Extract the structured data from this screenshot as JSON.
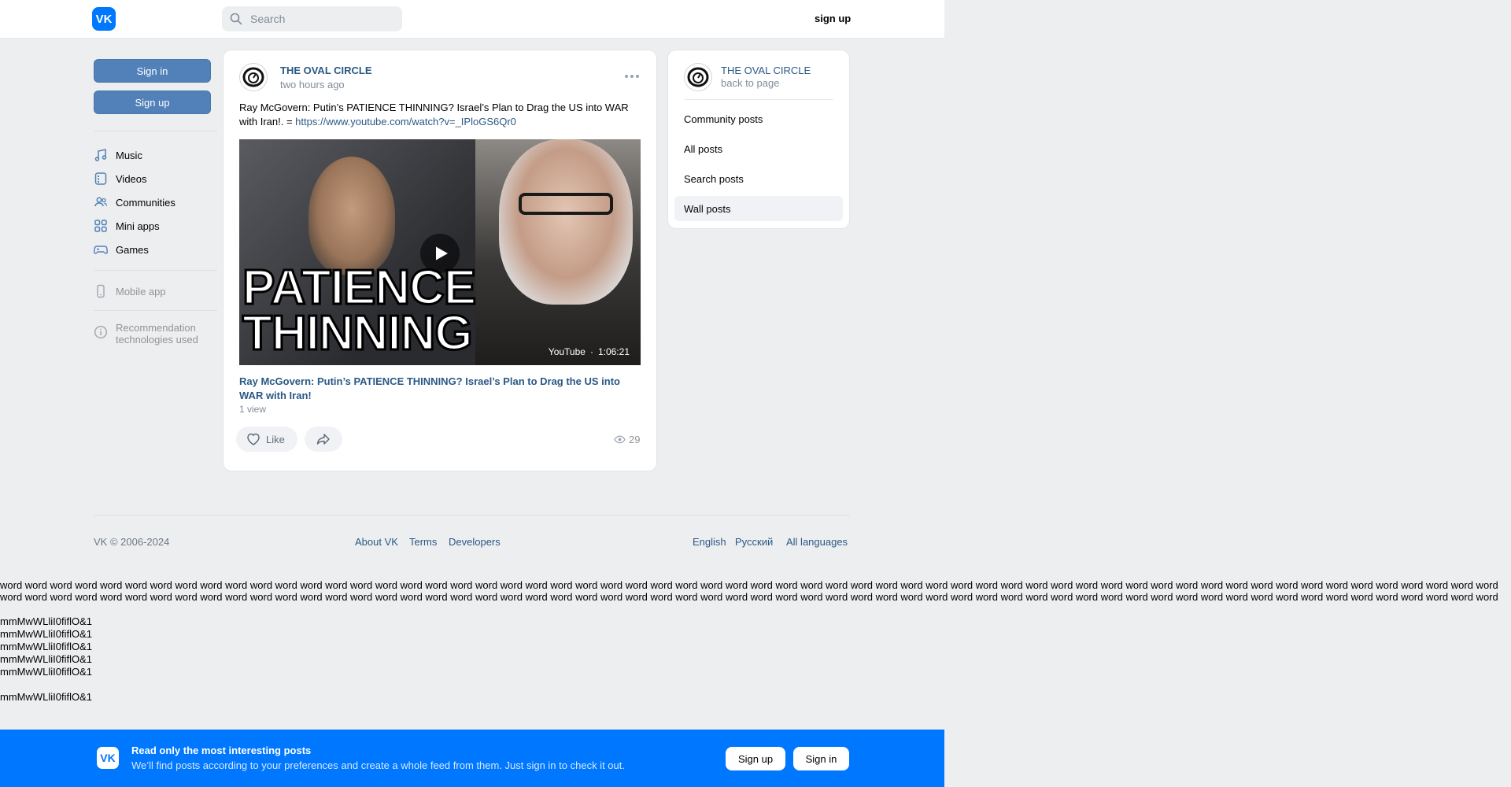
{
  "header": {
    "logo": "VK",
    "search_placeholder": "Search",
    "signup": "sign up"
  },
  "sidebar": {
    "signin": "Sign in",
    "signup": "Sign up",
    "menu": [
      {
        "label": "Music",
        "icon": "music-icon"
      },
      {
        "label": "Videos",
        "icon": "video-icon"
      },
      {
        "label": "Communities",
        "icon": "communities-icon"
      },
      {
        "label": "Mini apps",
        "icon": "apps-icon"
      },
      {
        "label": "Games",
        "icon": "gamepad-icon"
      }
    ],
    "mobile_app": "Mobile app",
    "recommendation": "Recommendation technologies used"
  },
  "post": {
    "author": "THE OVAL CIRCLE",
    "time": "two hours ago",
    "text": "Ray McGovern: Putin’s PATIENCE THINNING? Israel’s Plan to Drag the US into WAR with Iran!. = ",
    "link": "https://www.youtube.com/watch?v=_IPloGS6Qr0",
    "video": {
      "thumb_line1": "PATIENCE",
      "thumb_line2": "THINNING",
      "source": "YouTube",
      "separator": "·",
      "duration": "1:06:21",
      "title": "Ray McGovern: Putin’s PATIENCE THINNING? Israel’s Plan to Drag the US into WAR with Iran!",
      "views": "1 view"
    },
    "like_label": "Like",
    "view_count": "29"
  },
  "right_panel": {
    "name": "THE OVAL CIRCLE",
    "back": "back to page",
    "items": [
      {
        "label": "Community posts"
      },
      {
        "label": "All posts"
      },
      {
        "label": "Search posts"
      },
      {
        "label": "Wall posts"
      }
    ]
  },
  "footer": {
    "copyright": "VK © 2006-2024",
    "links": [
      "About VK",
      "Terms",
      "Developers"
    ],
    "languages": [
      "English",
      "Русский",
      "All languages"
    ]
  },
  "test_text": {
    "words_line": "word word word word word word word word word word word word word word word word word word word word word word word word word word word word word word word word word word word word word word word word word word word word word word word word word word word word word word word word word word word word",
    "glyph_line": "mmMwWLliI0fiflO&1"
  },
  "banner": {
    "logo": "VK",
    "title": "Read only the most interesting posts",
    "subtitle": "We’ll find posts according to your preferences and create a whole feed from them. Just sign in to check it out.",
    "signup": "Sign up",
    "signin": "Sign in"
  },
  "colors": {
    "accent": "#0077ff",
    "button": "#5181b8",
    "link": "#2a5885",
    "background": "#edeef0"
  }
}
